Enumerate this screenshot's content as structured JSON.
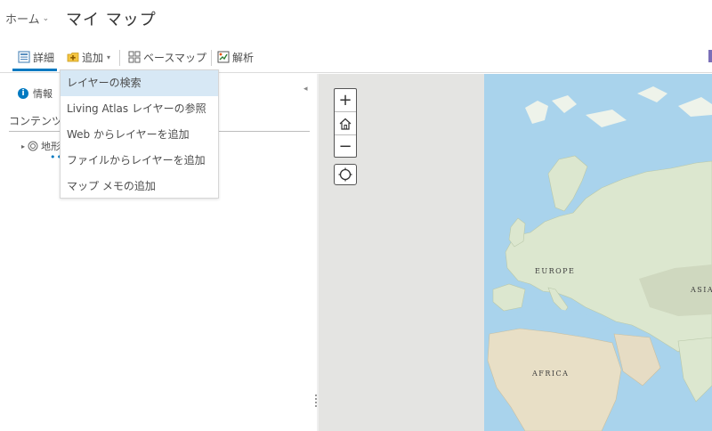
{
  "header": {
    "home_label": "ホーム",
    "home_chevron": "⌄",
    "map_title": "マイ マップ"
  },
  "toolbar": {
    "details_label": "詳細",
    "add_label": "追加",
    "add_caret": "▾",
    "basemap_label": "ベースマップ",
    "analysis_label": "解析"
  },
  "left_panel": {
    "info_tab_label": "情報",
    "collapse_arrow": "◂",
    "content_title": "コンテンツ",
    "layer_label": "地形",
    "layer_toggle": "▸",
    "layer_more": "•••"
  },
  "add_menu": {
    "items": [
      {
        "label": "レイヤーの検索"
      },
      {
        "label": "Living Atlas レイヤーの参照"
      },
      {
        "label": "Web からレイヤーを追加"
      },
      {
        "label": "ファイルからレイヤーを追加"
      },
      {
        "label": "マップ メモの追加"
      }
    ]
  },
  "map": {
    "zoom_in": "+",
    "zoom_out": "−",
    "labels": {
      "europe": "EUROPE",
      "asia": "ASIA",
      "africa": "AFRICA"
    }
  },
  "colors": {
    "accent": "#0079c1",
    "ocean": "#a9d3ec",
    "land": "#dce7cf",
    "menu_highlight": "#d7e8f5"
  }
}
